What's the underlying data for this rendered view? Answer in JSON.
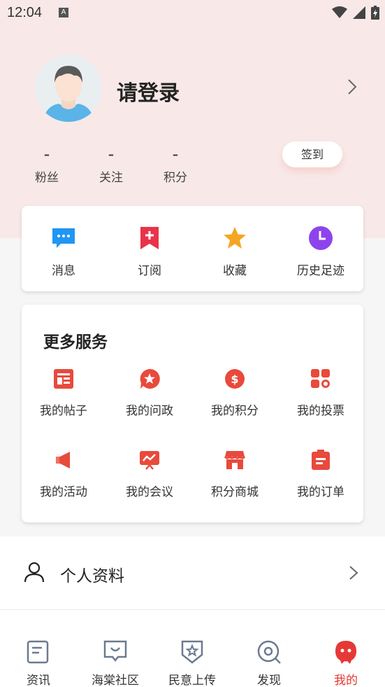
{
  "status_bar": {
    "time": "12:04",
    "keyboard_badge": "A"
  },
  "profile": {
    "login_prompt": "请登录"
  },
  "stats": [
    {
      "value": "-",
      "label": "粉丝"
    },
    {
      "value": "-",
      "label": "关注"
    },
    {
      "value": "-",
      "label": "积分"
    }
  ],
  "checkin": {
    "label": "签到"
  },
  "quick_actions": [
    {
      "label": "消息",
      "icon": "message-icon",
      "color": "#2196f3"
    },
    {
      "label": "订阅",
      "icon": "subscribe-icon",
      "color": "#e8334a"
    },
    {
      "label": "收藏",
      "icon": "star-icon",
      "color": "#f5a623"
    },
    {
      "label": "历史足迹",
      "icon": "clock-icon",
      "color": "#8e44ec"
    }
  ],
  "services": {
    "title": "更多服务",
    "items": [
      {
        "label": "我的帖子",
        "icon": "post-icon"
      },
      {
        "label": "我的问政",
        "icon": "inquiry-icon"
      },
      {
        "label": "我的积分",
        "icon": "points-icon"
      },
      {
        "label": "我的投票",
        "icon": "vote-icon"
      },
      {
        "label": "我的活动",
        "icon": "activity-icon"
      },
      {
        "label": "我的会议",
        "icon": "meeting-icon"
      },
      {
        "label": "积分商城",
        "icon": "store-icon"
      },
      {
        "label": "我的订单",
        "icon": "order-icon"
      }
    ],
    "accent": "#e84a3c"
  },
  "list": [
    {
      "label": "个人资料",
      "icon": "person-icon"
    }
  ],
  "tabs": [
    {
      "label": "资讯",
      "icon": "news-icon",
      "active": false
    },
    {
      "label": "海棠社区",
      "icon": "community-icon",
      "active": false
    },
    {
      "label": "民意上传",
      "icon": "opinion-icon",
      "active": false
    },
    {
      "label": "发现",
      "icon": "discover-icon",
      "active": false
    },
    {
      "label": "我的",
      "icon": "mine-icon",
      "active": true
    }
  ],
  "colors": {
    "header_bg": "#f8e9e8",
    "active_tab": "#e53935"
  }
}
